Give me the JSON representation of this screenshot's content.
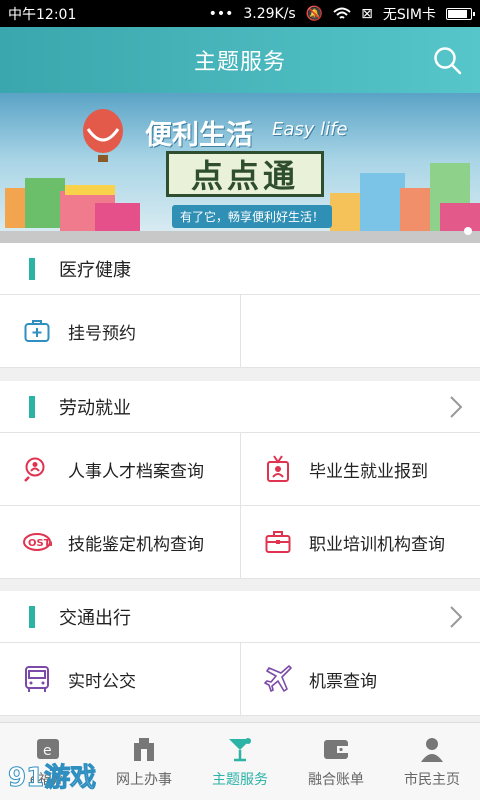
{
  "status": {
    "time": "中午12:01",
    "speed": "3.29K/s",
    "sim": "无SIM卡"
  },
  "header": {
    "title": "主题服务",
    "search_icon": "search-icon"
  },
  "banner": {
    "title_cn": "便利生活",
    "title_en": "Easy life",
    "headline": "点点通",
    "subtitle": "有了它，畅享便利好生活！"
  },
  "sections": [
    {
      "name": "医疗健康",
      "items": [
        {
          "label": "挂号预约",
          "icon": "medical-kit-icon",
          "color": "#2f8fc0"
        }
      ]
    },
    {
      "name": "劳动就业",
      "items": [
        {
          "label": "人事人才档案查询",
          "icon": "person-search-icon",
          "color": "#e0334f"
        },
        {
          "label": "毕业生就业报到",
          "icon": "badge-icon",
          "color": "#e0334f"
        },
        {
          "label": "技能鉴定机构查询",
          "icon": "certificate-icon",
          "color": "#e0334f"
        },
        {
          "label": "职业培训机构查询",
          "icon": "briefcase-icon",
          "color": "#e0334f"
        }
      ]
    },
    {
      "name": "交通出行",
      "items": [
        {
          "label": "实时公交",
          "icon": "bus-icon",
          "color": "#7c4aa8"
        },
        {
          "label": "机票查询",
          "icon": "plane-icon",
          "color": "#7c4aa8"
        }
      ]
    }
  ],
  "tabs": [
    {
      "label": "e福州",
      "icon": "e-fuzhou-icon"
    },
    {
      "label": "网上办事",
      "icon": "office-icon"
    },
    {
      "label": "主题服务",
      "icon": "cocktail-icon",
      "active": true
    },
    {
      "label": "融合账单",
      "icon": "wallet-icon"
    },
    {
      "label": "市民主页",
      "icon": "person-icon"
    }
  ],
  "watermark": "91游戏",
  "colors": {
    "accent": "#2bb3a6",
    "header": "#45b6bc"
  }
}
